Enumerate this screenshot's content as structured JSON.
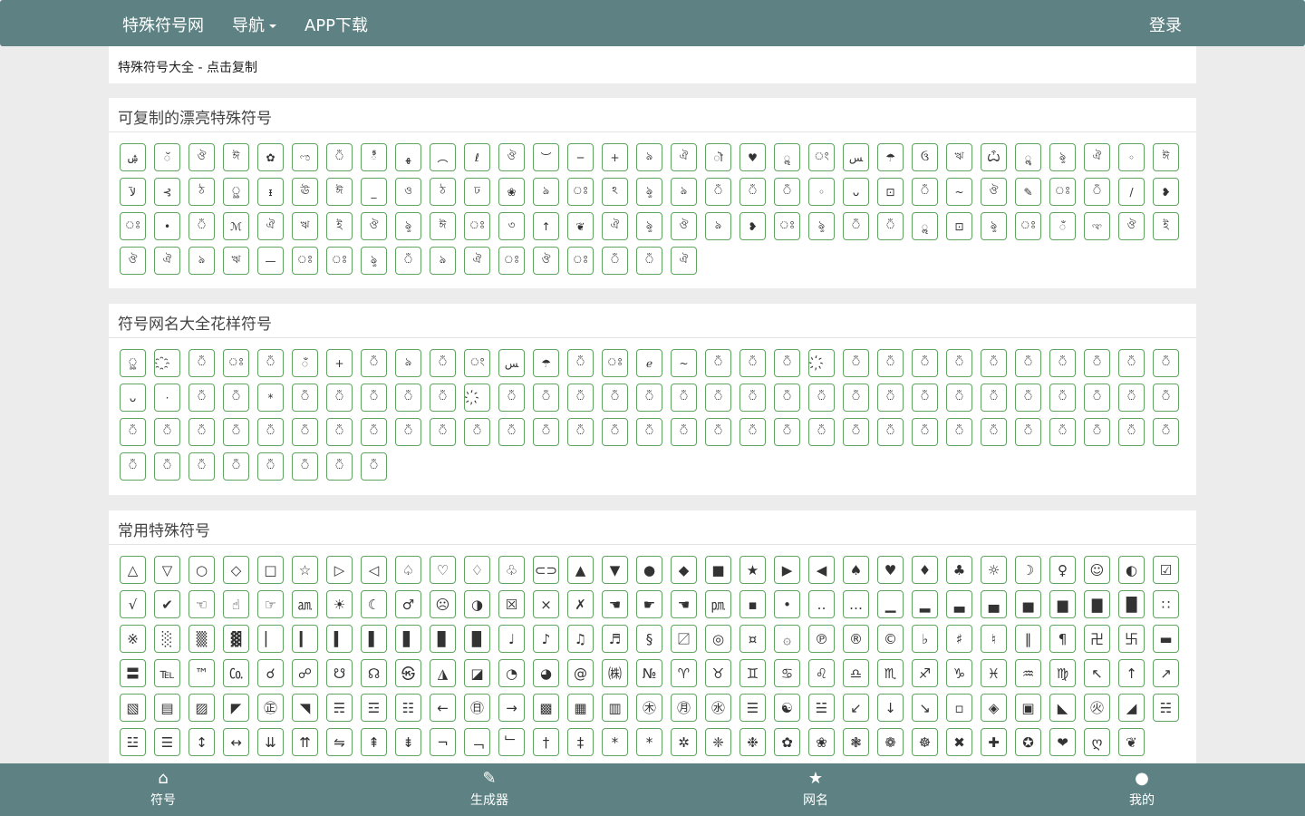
{
  "nav": {
    "brand": "特殊符号网",
    "menu": "导航",
    "app": "APP下载",
    "login": "登录"
  },
  "breadcrumb": "特殊符号大全 - 点击复制",
  "sections": [
    {
      "title": "可复制的漂亮特殊符号",
      "symbols": [
        "ۺ",
        "ॅ",
        "ঔ",
        "ঈ",
        "✿",
        "ಌ",
        "ঁ",
        "ీ",
        "ﻬ",
        "︵",
        "ℓ",
        "ঔ",
        "︶",
        "─",
        "+",
        "ঌ",
        "ঐ",
        "ॊ",
        "♥",
        "ॢ",
        "ং",
        "ﺲ",
        "☂",
        "ઉ",
        "ঋ",
        "Ѽ",
        "ॣ",
        "ৡ",
        "ঐ",
        "◦",
        "ঈ",
        "ﻵ",
        "⊰",
        "ঠ",
        "ৣ",
        "ᵻ",
        "ঊ",
        "ঈ",
        "_",
        "ও",
        "ঠ",
        "ঢ",
        "❀",
        "ঌ",
        "ঃ",
        "ঽ",
        "ৡ",
        "ঌ",
        "ঁ",
        "ঁ",
        "ঁ",
        "◦",
        "ᴗ",
        "⊡",
        "ঁ",
        "~",
        "ঔ",
        "✎",
        "ঃ",
        "ঁ",
        "/",
        "❥",
        "ঃ",
        "•",
        "ঁ",
        "ℳ",
        "ঐ",
        "ঋ",
        "ই",
        "ঔ",
        "ৡ",
        "ঈ",
        "ঃ",
        "৩",
        "↑",
        "❦",
        "ঐ",
        "ৡ",
        "ঔ",
        "ঌ",
        "❥",
        "ঃ",
        "ৡ",
        "ঁ",
        "ঁ",
        "ॢ",
        "⊡",
        "ৡ",
        "ঃ",
        "ँ",
        "ಞ",
        "ঔ",
        "ই",
        "ঔ",
        "ঐ",
        "ঌ",
        "ঋ",
        "—",
        "ঃ",
        "ঃ",
        "ৡ",
        "ঁ",
        "ঌ",
        "ঐ",
        "ঃ",
        "ঔ",
        "ঃ",
        "ঁ",
        "ঁ",
        "ঐ"
      ]
    },
    {
      "title": "符号网名大全花样符号",
      "symbols": [
        "ৣ",
        "҈",
        "ঁ",
        "ঃ",
        "ঁ",
        "ँ",
        "+",
        "ঁ",
        "ঌ",
        "ঁ",
        "ং",
        "ﺲ",
        "☂",
        "ঁ",
        "ঃ",
        "ℯ",
        "~",
        "ঁ",
        "ঁ",
        "ঁ",
        "҉",
        "ঁ",
        "ঁ",
        "ঁ",
        "ঁ",
        "ঁ",
        "ঁ",
        "ঁ",
        "ঁ",
        "ঁ",
        "ঁ",
        "ᴗ",
        "·",
        "ঁ",
        "ঁ",
        "*",
        "ঁ",
        "ঁ",
        "ঁ",
        "ঁ",
        "ঁ",
        "҉",
        "ঁ",
        "ঁ",
        "ঁ",
        "ঁ",
        "ঁ",
        "ঁ",
        "ঁ",
        "ঁ",
        "ঁ",
        "ঁ",
        "ঁ",
        "ঁ",
        "ঁ",
        "ঁ",
        "ঁ",
        "ঁ",
        "ঁ",
        "ঁ",
        "ঁ",
        "ঁ",
        "ঁ",
        "ঁ",
        "ঁ",
        "ঁ",
        "ঁ",
        "ঁ",
        "ঁ",
        "ঁ",
        "ঁ",
        "ঁ",
        "ঁ",
        "ঁ",
        "ঁ",
        "ঁ",
        "ঁ",
        "ঁ",
        "ঁ",
        "ঁ",
        "ঁ",
        "ঁ",
        "ঁ",
        "ঁ",
        "ঁ",
        "ঁ",
        "ঁ",
        "ঁ",
        "ঁ",
        "ঁ",
        "ঁ",
        "ঁ",
        "ঁ",
        "ঁ",
        "ঁ",
        "ঁ",
        "ঁ",
        "ঁ",
        "ঁ",
        "ঁ",
        "ঁ"
      ]
    },
    {
      "title": "常用特殊符号",
      "symbols": [
        "△",
        "▽",
        "○",
        "◇",
        "□",
        "☆",
        "▷",
        "◁",
        "♤",
        "♡",
        "♢",
        "♧",
        "⊂⊃",
        "▲",
        "▼",
        "●",
        "◆",
        "■",
        "★",
        "▶",
        "◀",
        "♠",
        "♥",
        "♦",
        "♣",
        "☼",
        "☽",
        "♀",
        "☺",
        "◐",
        "☑",
        "√",
        "✔",
        "☜",
        "☝",
        "☞",
        "㏂",
        "☀",
        "☾",
        "♂",
        "☹",
        "◑",
        "☒",
        "×",
        "✗",
        "☚",
        "☛",
        "☚",
        "㏘",
        "▪",
        "•",
        "‥",
        "…",
        "▁",
        "▂",
        "▃",
        "▄",
        "▅",
        "▆",
        "▇",
        "█",
        "∷",
        "※",
        "░",
        "▒",
        "▓",
        "▏",
        "▎",
        "▍",
        "▌",
        "▋",
        "▊",
        "▉",
        "♩",
        "♪",
        "♫",
        "♬",
        "§",
        "〼",
        "◎",
        "¤",
        "۞",
        "℗",
        "®",
        "©",
        "♭",
        "♯",
        "♮",
        "‖",
        "¶",
        "卍",
        "卐",
        "▬",
        "〓",
        "℡",
        "™",
        "㏇",
        "☌",
        "☍",
        "☋",
        "☊",
        "㉿",
        "◮",
        "◪",
        "◔",
        "◕",
        "@",
        "㈱",
        "№",
        "♈",
        "♉",
        "♊",
        "♋",
        "♌",
        "♎",
        "♏",
        "♐",
        "♑",
        "♓",
        "♒",
        "♍",
        "↖",
        "↑",
        "↗",
        "▧",
        "▤",
        "▨",
        "◤",
        "㊣",
        "◥",
        "☴",
        "☲",
        "☷",
        "←",
        "㊐",
        "→",
        "▩",
        "▦",
        "▥",
        "㊍",
        "㊊",
        "㊌",
        "☰",
        "☯",
        "☱",
        "↙",
        "↓",
        "↘",
        "▫",
        "◈",
        "▣",
        "◣",
        "㊋",
        "◢",
        "☵",
        "☳",
        "☰",
        "↕",
        "↔",
        "⇊",
        "⇈",
        "⇋",
        "⇞",
        "⇟",
        "¬",
        "﹁",
        "﹂",
        "†",
        "‡",
        "*",
        "*",
        "✲",
        "❈",
        "❉",
        "✿",
        "❀",
        "❃",
        "❁",
        "☸",
        "✖",
        "✚",
        "✪",
        "❤",
        "ღ",
        "❦"
      ]
    }
  ],
  "bottom_tabs": [
    {
      "icon": "home-icon",
      "label": "符号"
    },
    {
      "icon": "wrench-icon",
      "label": "生成器"
    },
    {
      "icon": "star-icon",
      "label": "网名"
    },
    {
      "icon": "user-icon",
      "label": "我的"
    }
  ]
}
